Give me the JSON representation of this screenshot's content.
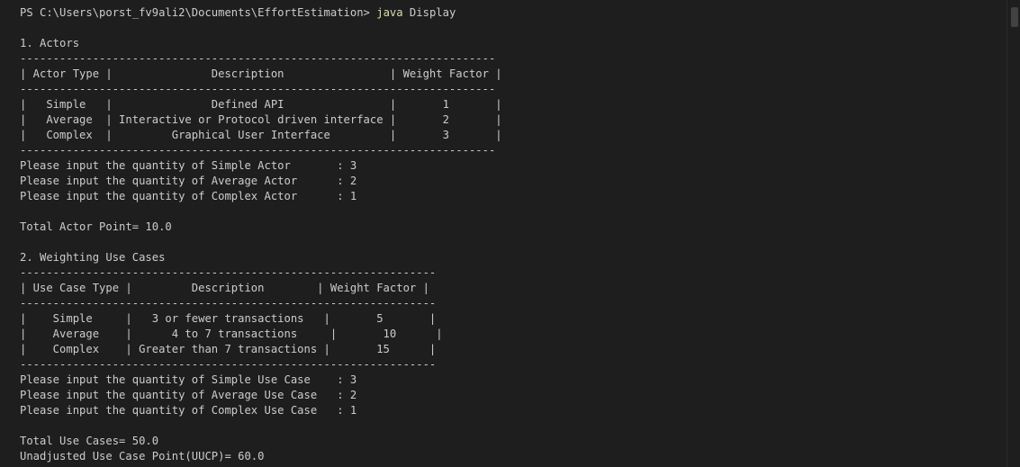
{
  "terminal": {
    "prompt": "PS C:\\Users\\porst_fv9ali2\\Documents\\EffortEstimation> ",
    "command": "java",
    "argument": " Display",
    "actors": {
      "heading": "1. Actors",
      "rule": "------------------------------------------------------------------------",
      "header_row": "| Actor Type |               Description                | Weight Factor |",
      "rows": [
        "|   Simple   |               Defined API                |       1       |",
        "|   Average  | Interactive or Protocol driven interface |       2       |",
        "|   Complex  |         Graphical User Interface         |       3       |"
      ],
      "prompts": [
        "Please input the quantity of Simple Actor       : 3",
        "Please input the quantity of Average Actor      : 2",
        "Please input the quantity of Complex Actor      : 1"
      ],
      "total": "Total Actor Point= 10.0"
    },
    "use_cases": {
      "heading": "2. Weighting Use Cases",
      "rule": "---------------------------------------------------------------",
      "header_row": "| Use Case Type |         Description        | Weight Factor |",
      "rows": [
        "|    Simple     |   3 or fewer transactions   |       5       |",
        "|    Average    |      4 to 7 transactions     |       10      |",
        "|    Complex    | Greater than 7 transactions |       15      |"
      ],
      "prompts": [
        "Please input the quantity of Simple Use Case    : 3",
        "Please input the quantity of Average Use Case   : 2",
        "Please input the quantity of Complex Use Case   : 1"
      ],
      "total_use_cases": "Total Use Cases= 50.0",
      "uucp": "Unadjusted Use Case Point(UUCP)= 60.0"
    }
  },
  "colors": {
    "background": "#1e1e1e",
    "text": "#cccccc",
    "command": "#dcdcaa"
  }
}
